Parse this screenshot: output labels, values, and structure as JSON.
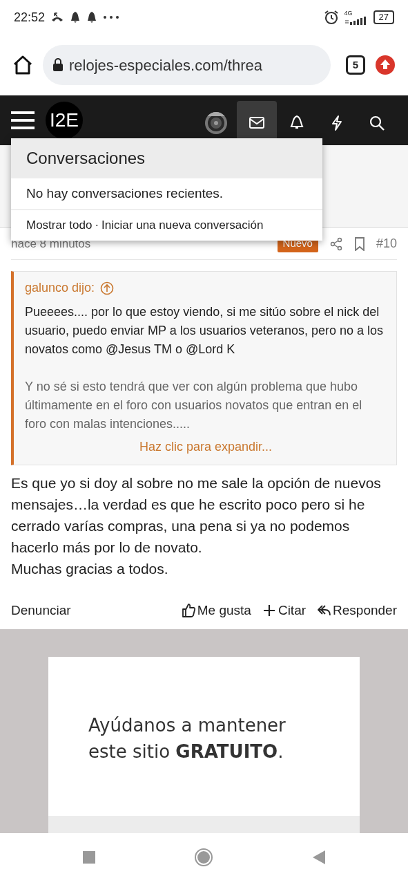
{
  "status_bar": {
    "time": "22:52",
    "network": "4G",
    "battery": "27"
  },
  "browser": {
    "url": "relojes-especiales.com/threa",
    "tab_count": "5"
  },
  "navbar": {
    "logo": "I2E",
    "items": [
      {
        "kind": "mail",
        "selected": true
      },
      {
        "kind": "bell",
        "selected": false
      },
      {
        "kind": "bolt",
        "selected": false
      },
      {
        "kind": "search",
        "selected": false
      }
    ]
  },
  "conversations_menu": {
    "title": "Conversaciones",
    "empty_text": "No hay conversaciones recientes.",
    "links": [
      "Mostrar todo",
      "Iniciar una nueva conversación"
    ],
    "separator": "·"
  },
  "post": {
    "time": "hace 8 minutos",
    "badge": "Nuevo",
    "number": "#10",
    "quote": {
      "author": "galunco dijo:",
      "paragraphs": [
        "Pueeees.... por lo que estoy viendo, si me sitúo sobre el nick del usuario, puedo enviar MP a los usuarios veteranos, pero no a los novatos como @Jesus TM o @Lord K",
        "Y no sé si esto tendrá que ver con algún problema que hubo últimamente en el foro con usuarios novatos que entran en el foro con malas intenciones....."
      ],
      "expand": "Haz clic para expandir..."
    },
    "body": "Es que yo si doy al sobre no me sale la opción de nuevos mensajes…la verdad es que he escrito poco pero si he cerrado varías compras, una pena si ya no podemos hacerlo más por lo de novato.\nMuchas gracias a todos.",
    "report": "Denunciar",
    "actions": [
      {
        "kind": "like",
        "label": "Me gusta"
      },
      {
        "kind": "quote",
        "label": "Citar"
      },
      {
        "kind": "reply",
        "label": "Responder"
      }
    ]
  },
  "ad": {
    "text": "Ayúdanos a mantener este sitio **GRATUITO**."
  }
}
